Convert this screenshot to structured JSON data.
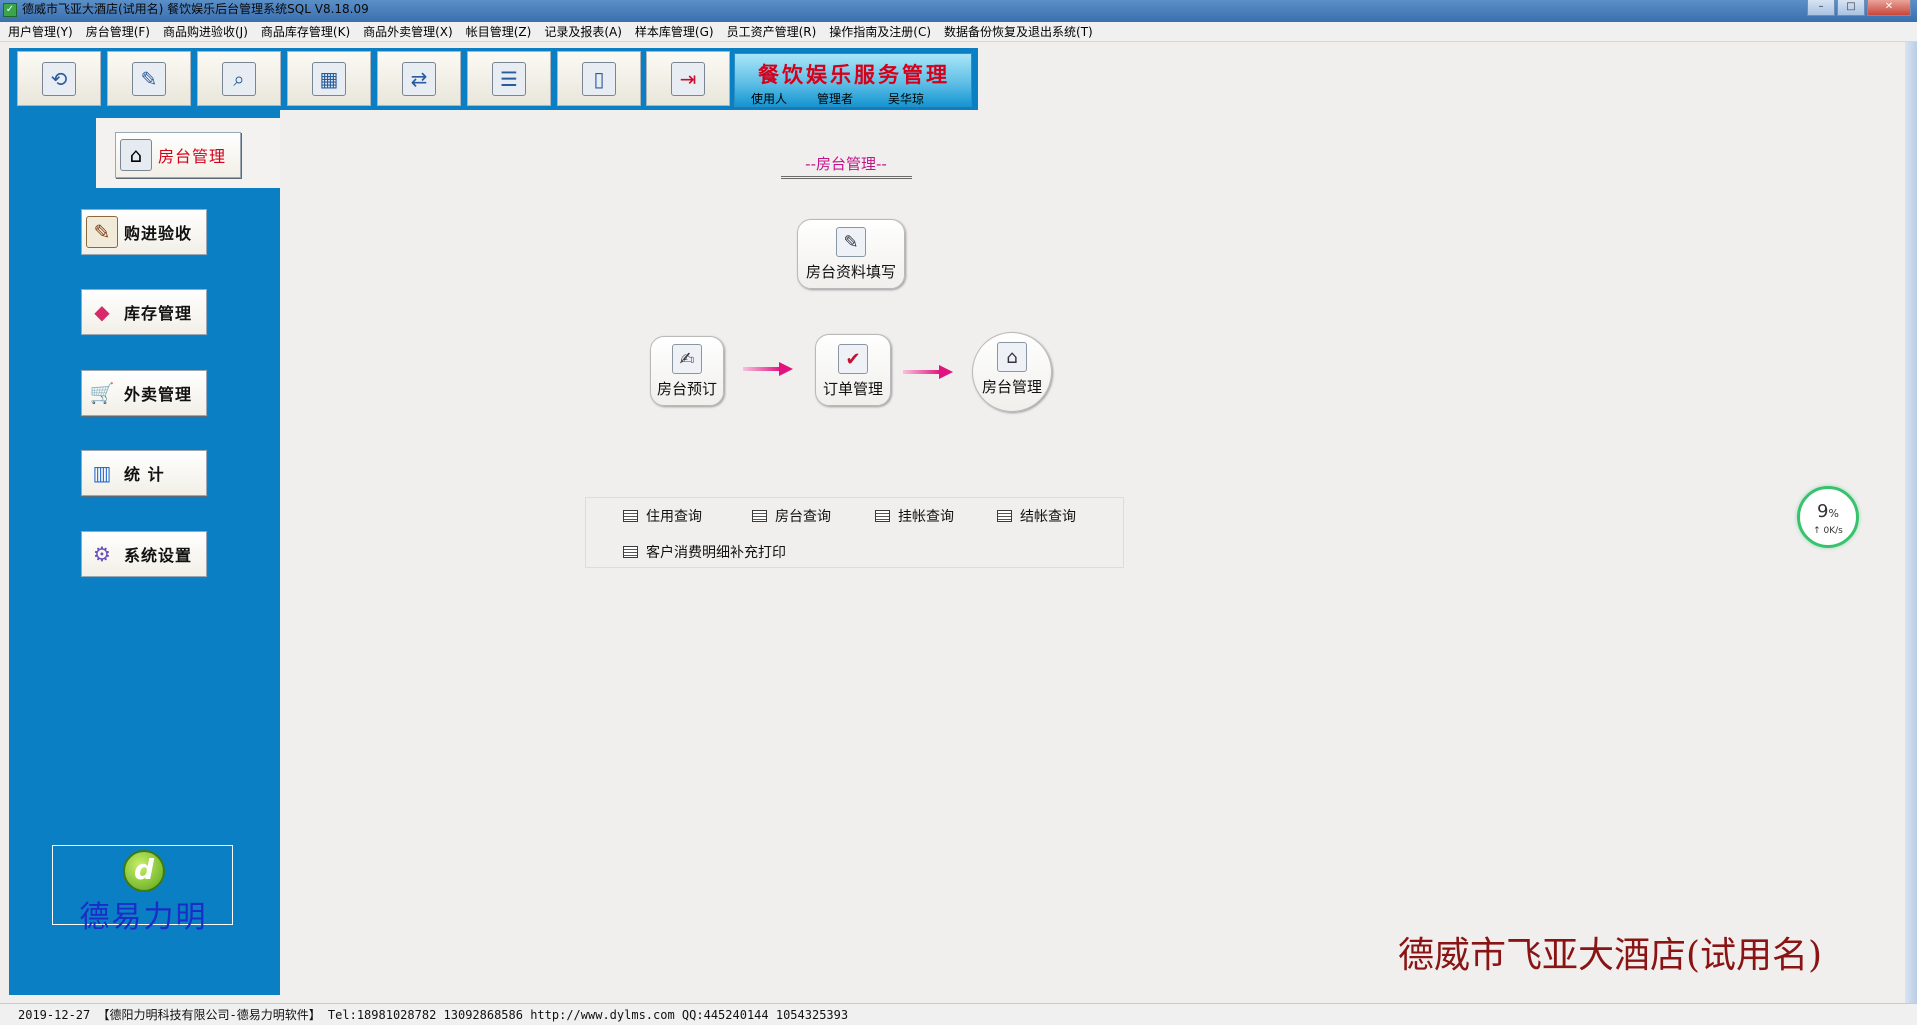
{
  "window": {
    "title": "德威市飞亚大酒店(试用名) 餐饮娱乐后台管理系统SQL V8.18.09",
    "controls": [
      "minimize",
      "maximize",
      "close"
    ]
  },
  "menu": [
    "用户管理(Y)",
    "房台管理(F)",
    "商品购进验收(J)",
    "商品库存管理(K)",
    "商品外卖管理(X)",
    "帐目管理(Z)",
    "记录及报表(A)",
    "样本库管理(G)",
    "员工资产管理(R)",
    "操作指南及注册(C)",
    "数据备份恢复及退出系统(T)"
  ],
  "toolbar": {
    "buttons": [
      {
        "icon": "refresh-icon",
        "glyph": "⟲"
      },
      {
        "icon": "edit-document-icon",
        "glyph": "✎"
      },
      {
        "icon": "magnifier-icon",
        "glyph": "⌕"
      },
      {
        "icon": "excel-icon",
        "glyph": "▦"
      },
      {
        "icon": "transfer-icon",
        "glyph": "⇄"
      },
      {
        "icon": "id-card-icon",
        "glyph": "☰"
      },
      {
        "icon": "book-icon",
        "glyph": "▯"
      },
      {
        "icon": "exit-door-icon",
        "glyph": "⇥"
      }
    ]
  },
  "banner": {
    "title": "餐饮娱乐服务管理",
    "user_label": "使用人",
    "role": "管理者",
    "user_name": "吴华琼"
  },
  "sidebar": {
    "selected": {
      "label": "房台管理",
      "icon": "room-management-icon"
    },
    "items": [
      {
        "label": "购进验收",
        "icon": "purchase-check-icon",
        "glyph": "✎"
      },
      {
        "label": "库存管理",
        "icon": "inventory-cubes-icon",
        "glyph": "◆"
      },
      {
        "label": "外卖管理",
        "icon": "shopping-cart-icon",
        "glyph": "🛒"
      },
      {
        "label": "统  计",
        "icon": "statistics-chart-icon",
        "glyph": "▥"
      },
      {
        "label": "系统设置",
        "icon": "settings-gears-icon",
        "glyph": "⚙"
      }
    ],
    "logo_text": "德易力明"
  },
  "main": {
    "section_title": "--房台管理--",
    "flow": {
      "top": {
        "label": "房台资料填写",
        "icon": "room-info-edit-icon",
        "glyph": "✎"
      },
      "steps": [
        {
          "label": "房台预订",
          "icon": "room-booking-icon",
          "glyph": "✍"
        },
        {
          "label": "订单管理",
          "icon": "order-management-icon",
          "glyph": "✔"
        },
        {
          "label": "房台管理",
          "icon": "room-management-icon",
          "glyph": "⌂"
        }
      ]
    },
    "queries": [
      "住用查询",
      "房台查询",
      "挂帐查询",
      "结帐查询",
      "客户消费明细补充打印"
    ],
    "hotel_name": "德威市飞亚大酒店(试用名)"
  },
  "net_widget": {
    "percent": "9",
    "percent_unit": "%",
    "speed": "↑ 0K/s"
  },
  "statusbar": {
    "text": "2019-12-27 【德阳力明科技有限公司-德易力明软件】 Tel:18981028782 13092868586 http://www.dylms.com QQ:445240144 1054325393"
  }
}
